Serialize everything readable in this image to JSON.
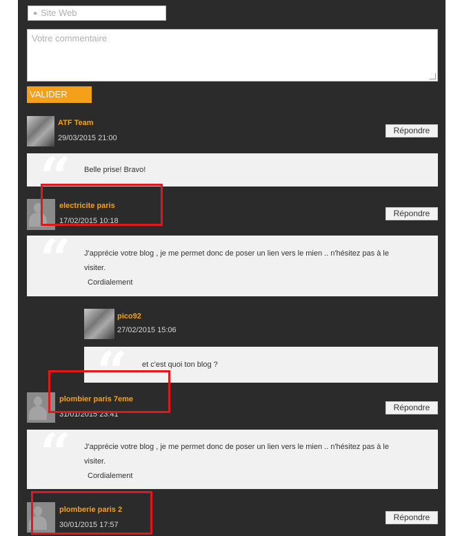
{
  "form": {
    "site_placeholder": "Site Web",
    "comment_placeholder": "Votre commentaire",
    "submit_label": "VALIDER"
  },
  "comments": [
    {
      "author": "ATF Team",
      "date": "29/03/2015 21:00",
      "reply_label": "Répondre",
      "lines": [
        "Belle prise! Bravo!"
      ]
    },
    {
      "author": "electricite paris",
      "date": "17/02/2015 10:18",
      "reply_label": "Répondre",
      "lines": [
        "J'apprécie votre blog , je me permet donc de poser un lien vers le mien .. n'hésitez pas à le",
        "visiter.",
        "Cordialement"
      ]
    },
    {
      "author": "pico92",
      "date": "27/02/2015 15:06",
      "lines": [
        "et c'est quoi ton blog ?"
      ]
    },
    {
      "author": "plombier paris 7eme",
      "date": "31/01/2015 23:41",
      "reply_label": "Répondre",
      "lines": [
        "J'apprécie votre blog , je me permet donc de poser un lien vers le mien .. n'hésitez pas à le",
        "visiter.",
        "Cordialement"
      ]
    },
    {
      "author": "plomberie paris 2",
      "date": "30/01/2015 17:57",
      "reply_label": "Répondre"
    }
  ],
  "colors": {
    "background": "#2b2b2b",
    "accent": "#f5a01a",
    "highlight": "#e4161b",
    "bubble": "#f1f1f1"
  },
  "icons": [
    "link-icon",
    "quote-icon",
    "resize-handle-icon"
  ]
}
